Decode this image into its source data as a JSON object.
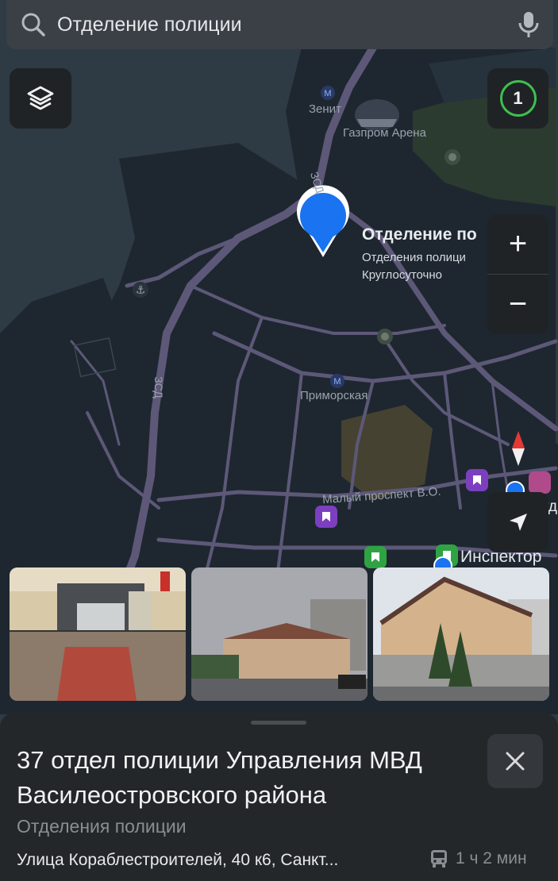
{
  "search": {
    "query": "Отделение полиции"
  },
  "map": {
    "labels": {
      "zenit": "Зенит",
      "gazprom_arena": "Газпром Арена",
      "zsd_top": "ЗСД",
      "zsd_left": "ЗСД",
      "primorskaya": "Приморская",
      "maly_prospekt": "Малый проспект В.О.",
      "otd_right": "Отд",
      "inspektor": "Инспектор"
    },
    "pin": {
      "title": "Отделение по",
      "subtitle": "Отделения полици",
      "hours": "Круглосуточно"
    },
    "results_count": "1",
    "zoom_in": "+",
    "zoom_out": "−"
  },
  "place": {
    "title": "37 отдел полиции Управления МВД Василеостровского района",
    "category": "Отделения полиции",
    "address": "Улица Кораблестроителей, 40 к6, Санкт...",
    "transit_time": "1 ч 2 мин"
  },
  "colors": {
    "map_bg": "#2e3a44",
    "land": "#1e2730",
    "road": "#5d5878",
    "pin": "#1a73f0",
    "park": "#3c5a3a",
    "results_ring": "#3fbf4f"
  },
  "icons": {
    "search": "search-icon",
    "mic": "microphone-icon",
    "layers": "layers-icon",
    "close": "close-icon",
    "bus": "bus-icon",
    "locate": "locate-arrow-icon",
    "compass": "compass-icon"
  }
}
